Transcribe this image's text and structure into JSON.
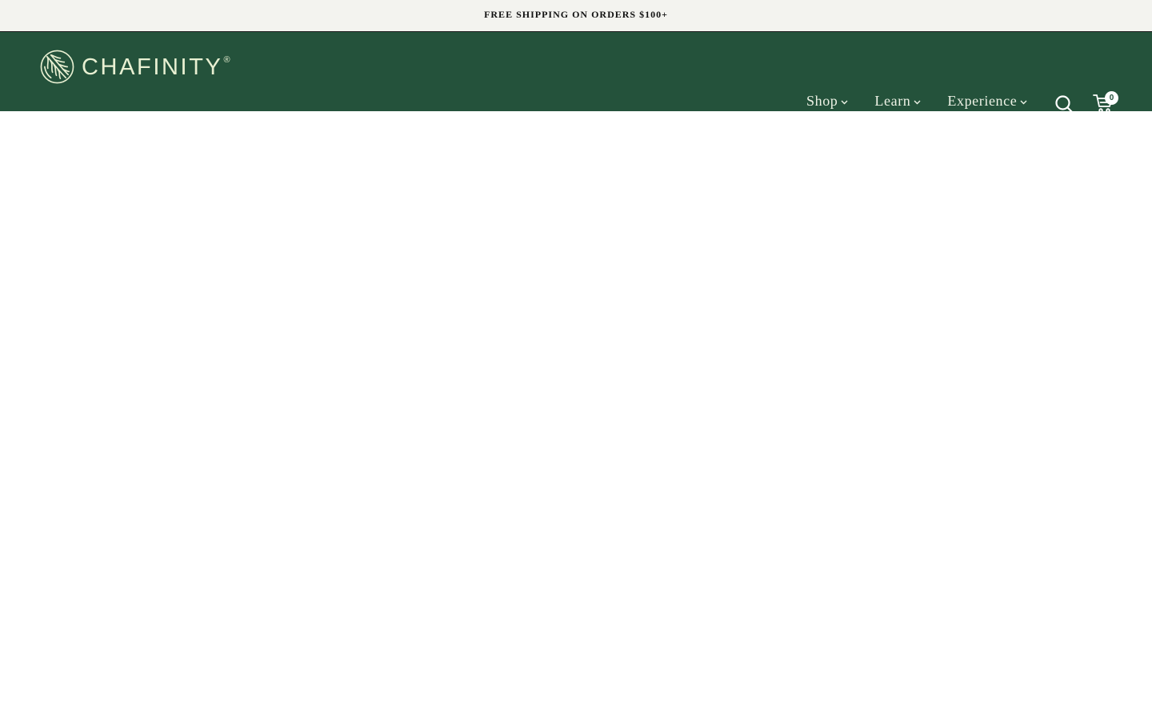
{
  "announcement": {
    "text": "FREE SHIPPING ON ORDERS $100+"
  },
  "header": {
    "logo": {
      "text": "CHAFINITY",
      "registered_mark": "®",
      "icon": "leaf-logo-icon"
    },
    "nav": [
      {
        "label": "Shop",
        "icon": "chevron-down-icon"
      },
      {
        "label": "Learn",
        "icon": "chevron-down-icon"
      },
      {
        "label": "Experience",
        "icon": "chevron-down-icon"
      }
    ],
    "search_icon": "search-icon",
    "cart": {
      "icon": "cart-icon",
      "count": "0"
    }
  },
  "colors": {
    "header_bg": "#24523b",
    "announcement_bg": "#f3f3ef",
    "logo": "#e8f0d2",
    "nav_text": "#eef3e6"
  }
}
